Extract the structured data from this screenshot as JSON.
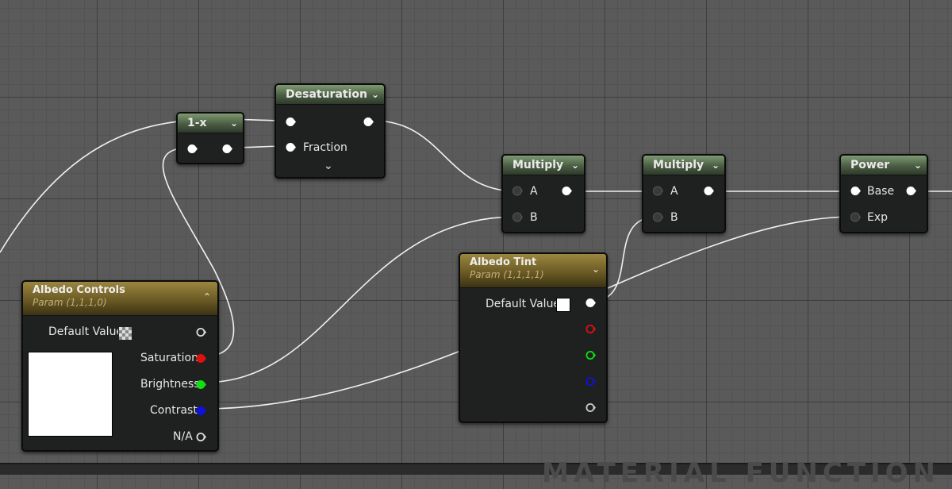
{
  "nodes": {
    "one_minus_x": {
      "title": "1-x"
    },
    "desaturation": {
      "title": "Desaturation",
      "pin_fraction": "Fraction"
    },
    "multiply_1": {
      "title": "Multiply",
      "pin_a": "A",
      "pin_b": "B"
    },
    "multiply_2": {
      "title": "Multiply",
      "pin_a": "A",
      "pin_b": "B"
    },
    "power": {
      "title": "Power",
      "pin_base": "Base",
      "pin_exp": "Exp"
    },
    "albedo_controls": {
      "title": "Albedo Controls",
      "subtitle": "Param (1,1,1,0)",
      "default_value": "Default Value",
      "saturation": "Saturation",
      "brightness": "Brightness",
      "contrast": "Contrast",
      "na": "N/A"
    },
    "albedo_tint": {
      "title": "Albedo Tint",
      "subtitle": "Param (1,1,1,1)",
      "default_value": "Default Value"
    }
  },
  "watermark": "MATERIAL FUNCTION",
  "colors": {
    "pin_white": "#ffffff",
    "pin_red": "#e01010",
    "pin_green": "#10e010",
    "pin_blue": "#1010e0",
    "wire": "#f2f2f2",
    "header_expression": "#5d7353",
    "header_param": "#7a6a2a"
  }
}
